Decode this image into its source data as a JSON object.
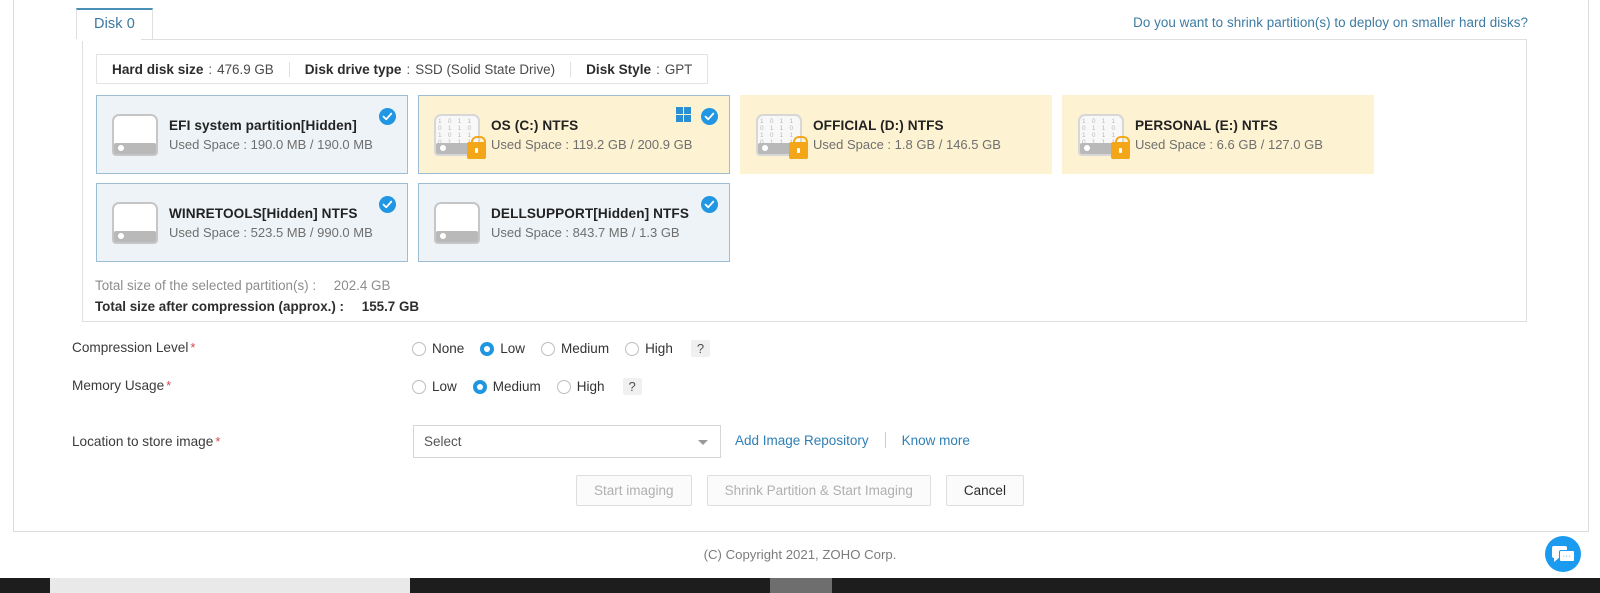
{
  "tab": {
    "label": "Disk 0"
  },
  "shrink_link": {
    "label": "Do you want to shrink partition(s) to deploy on smaller hard disks?"
  },
  "disk_info": [
    {
      "key": "Hard disk size",
      "sep": ":",
      "value": "476.9 GB"
    },
    {
      "key": "Disk drive type",
      "sep": ":",
      "value": "SSD (Solid State Drive)"
    },
    {
      "key": "Disk Style",
      "sep": ":",
      "value": "GPT"
    }
  ],
  "partitions": [
    {
      "title": "EFI system partition[Hidden]",
      "used_label": "Used Space : 190.0 MB / 190.0 MB",
      "selected": true,
      "style": "sel-light",
      "icon": "hard-drive-icon",
      "locked": false,
      "windows": false
    },
    {
      "title": "OS (C:) NTFS",
      "used_label": "Used Space : 119.2 GB / 200.9 GB",
      "selected": true,
      "style": "sel-yellow",
      "icon": "encrypted-drive-icon",
      "locked": true,
      "windows": true
    },
    {
      "title": "OFFICIAL (D:) NTFS",
      "used_label": "Used Space : 1.8 GB / 146.5 GB",
      "selected": false,
      "style": "unsel-yellow",
      "icon": "encrypted-drive-icon",
      "locked": true,
      "windows": false
    },
    {
      "title": "PERSONAL (E:) NTFS",
      "used_label": "Used Space : 6.6 GB / 127.0 GB",
      "selected": false,
      "style": "unsel-yellow",
      "icon": "encrypted-drive-icon",
      "locked": true,
      "windows": false
    },
    {
      "title": "WINRETOOLS[Hidden] NTFS",
      "used_label": "Used Space : 523.5 MB / 990.0 MB",
      "selected": true,
      "style": "sel-light",
      "icon": "hard-drive-icon",
      "locked": false,
      "windows": false
    },
    {
      "title": "DELLSUPPORT[Hidden] NTFS",
      "used_label": "Used Space : 843.7 MB / 1.3 GB",
      "selected": true,
      "style": "sel-light",
      "icon": "hard-drive-icon",
      "locked": false,
      "windows": false
    }
  ],
  "totals": {
    "selected_label": "Total size of the selected partition(s) :",
    "selected_value": "202.4 GB",
    "compressed_label": "Total size after compression (approx.) :",
    "compressed_value": "155.7 GB"
  },
  "compression": {
    "label": "Compression Level",
    "required": "*",
    "help": "?",
    "options": [
      "None",
      "Low",
      "Medium",
      "High"
    ],
    "selected": "Low"
  },
  "memory": {
    "label": "Memory Usage",
    "required": "*",
    "help": "?",
    "options": [
      "Low",
      "Medium",
      "High"
    ],
    "selected": "Medium"
  },
  "location": {
    "label": "Location to store image",
    "required": "*",
    "select_value": "Select",
    "add_repo": "Add Image Repository",
    "know_more": "Know more"
  },
  "buttons": [
    {
      "label": "Start imaging",
      "state": "disabled"
    },
    {
      "label": "Shrink Partition & Start Imaging",
      "state": "disabled"
    },
    {
      "label": "Cancel",
      "state": "enabled"
    }
  ],
  "footer": {
    "copyright": "(C) Copyright 2021, ZOHO Corp."
  },
  "chat": {
    "name": "chat-widget"
  },
  "colors": {
    "accent_blue": "#2196e3",
    "link_blue": "#3d7ba2",
    "card_yellow": "#fdf2d2",
    "card_light": "#eef3f7",
    "card_border": "#9dbdd4",
    "lock_orange": "#f3a617",
    "required_red": "#d24b4b"
  }
}
